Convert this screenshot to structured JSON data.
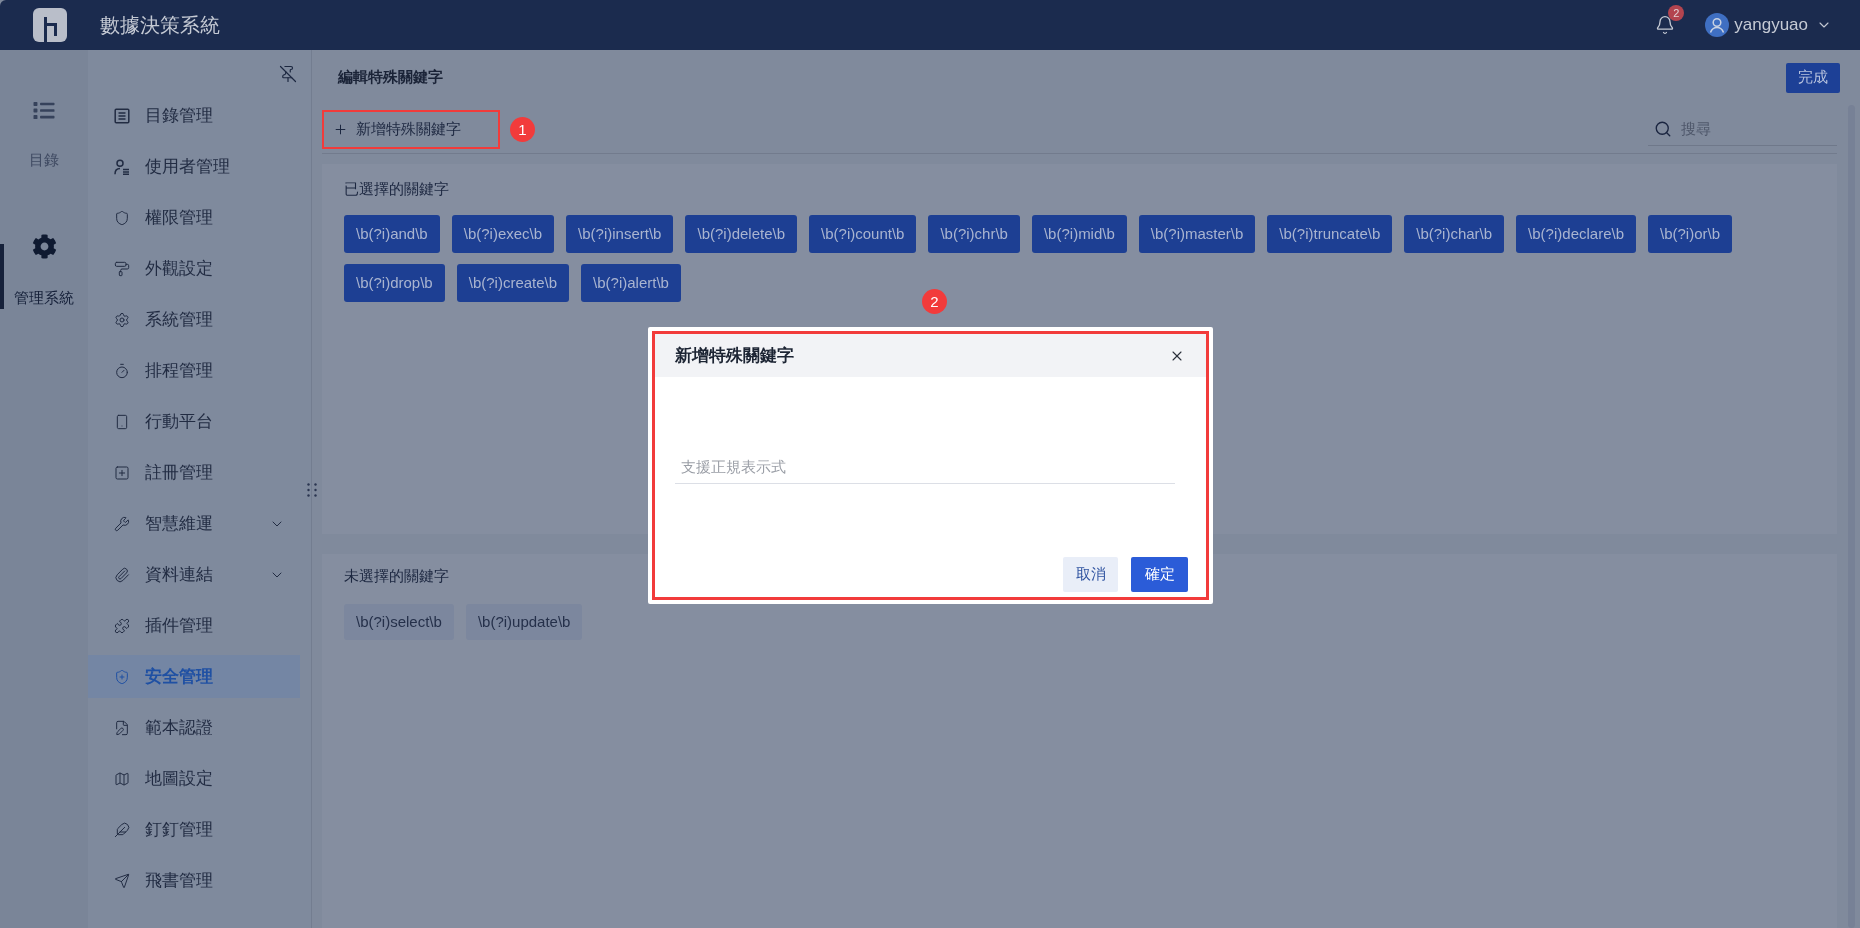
{
  "app": {
    "title": "數據決策系統"
  },
  "header": {
    "notification_count": "2",
    "user": "yangyuao"
  },
  "rail": [
    {
      "label": "目錄",
      "selected": false
    },
    {
      "label": "管理系統",
      "selected": true
    }
  ],
  "sidebar": {
    "items": [
      {
        "label": "目錄管理",
        "kind": "page",
        "selected": false
      },
      {
        "label": "使用者管理",
        "kind": "page",
        "selected": false
      },
      {
        "label": "權限管理",
        "kind": "page",
        "selected": false
      },
      {
        "label": "外觀設定",
        "kind": "page",
        "selected": false
      },
      {
        "label": "系統管理",
        "kind": "page",
        "selected": false
      },
      {
        "label": "排程管理",
        "kind": "page",
        "selected": false
      },
      {
        "label": "行動平台",
        "kind": "page",
        "selected": false
      },
      {
        "label": "註冊管理",
        "kind": "page",
        "selected": false
      },
      {
        "label": "智慧維運",
        "kind": "group",
        "selected": false
      },
      {
        "label": "資料連結",
        "kind": "group",
        "selected": false
      },
      {
        "label": "插件管理",
        "kind": "page",
        "selected": false
      },
      {
        "label": "安全管理",
        "kind": "page",
        "selected": true
      },
      {
        "label": "範本認證",
        "kind": "page",
        "selected": false
      },
      {
        "label": "地圖設定",
        "kind": "page",
        "selected": false
      },
      {
        "label": "釘釘管理",
        "kind": "page",
        "selected": false
      },
      {
        "label": "飛書管理",
        "kind": "page",
        "selected": false
      }
    ]
  },
  "page": {
    "title": "編輯特殊關鍵字",
    "done_button": "完成",
    "add_button": {
      "label": "新增特殊關鍵字",
      "callout": "1"
    },
    "search": {
      "placeholder": "搜尋"
    }
  },
  "selected_keywords": {
    "title": "已選擇的關鍵字",
    "tags": [
      "\\b(?i)and\\b",
      "\\b(?i)exec\\b",
      "\\b(?i)insert\\b",
      "\\b(?i)delete\\b",
      "\\b(?i)count\\b",
      "\\b(?i)chr\\b",
      "\\b(?i)mid\\b",
      "\\b(?i)master\\b",
      "\\b(?i)truncate\\b",
      "\\b(?i)char\\b",
      "\\b(?i)declare\\b",
      "\\b(?i)or\\b",
      "\\b(?i)drop\\b",
      "\\b(?i)create\\b",
      "\\b(?i)alert\\b"
    ]
  },
  "unselected_keywords": {
    "title": "未選擇的關鍵字",
    "tags": [
      "\\b(?i)select\\b",
      "\\b(?i)update\\b"
    ]
  },
  "dialog": {
    "callout": "2",
    "title": "新增特殊關鍵字",
    "input": {
      "placeholder": "支援正規表示式"
    },
    "buttons": [
      {
        "label": "取消",
        "kind": "secondary"
      },
      {
        "label": "確定",
        "kind": "primary"
      }
    ]
  }
}
